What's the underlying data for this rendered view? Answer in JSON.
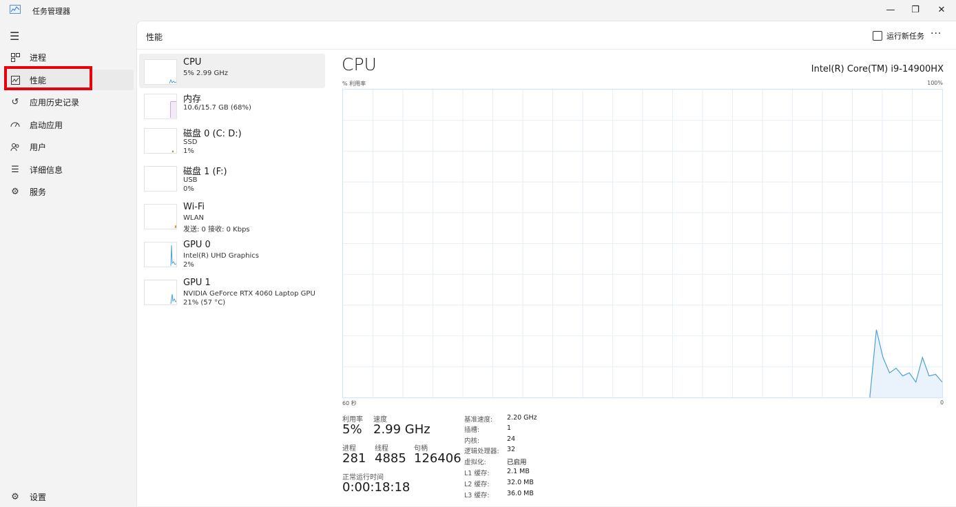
{
  "window": {
    "title": "任务管理器"
  },
  "sidebar": {
    "items": [
      {
        "label": "进程",
        "icon": "processes-icon"
      },
      {
        "label": "性能",
        "icon": "performance-icon"
      },
      {
        "label": "应用历史记录",
        "icon": "history-icon"
      },
      {
        "label": "启动应用",
        "icon": "startup-icon"
      },
      {
        "label": "用户",
        "icon": "users-icon"
      },
      {
        "label": "详细信息",
        "icon": "details-icon"
      },
      {
        "label": "服务",
        "icon": "services-icon"
      }
    ],
    "active_index": 1,
    "settings_label": "设置"
  },
  "header": {
    "title": "性能",
    "run_task": "运行新任务",
    "more": "···"
  },
  "devices": [
    {
      "name": "CPU",
      "line2": "5% 2.99 GHz",
      "line3": ""
    },
    {
      "name": "内存",
      "line2": "10.6/15.7 GB (68%)",
      "line3": ""
    },
    {
      "name": "磁盘 0 (C: D:)",
      "line2": "SSD",
      "line3": "1%"
    },
    {
      "name": "磁盘 1 (F:)",
      "line2": "USB",
      "line3": "0%"
    },
    {
      "name": "Wi-Fi",
      "line2": "WLAN",
      "line3": "发送: 0 接收: 0 Kbps"
    },
    {
      "name": "GPU 0",
      "line2": "Intel(R) UHD Graphics",
      "line3": "2%"
    },
    {
      "name": "GPU 1",
      "line2": "NVIDIA GeForce RTX 4060 Laptop GPU",
      "line3": "21% (57 °C)"
    }
  ],
  "cpu": {
    "title": "CPU",
    "model": "Intel(R) Core(TM) i9-14900HX",
    "util_label": "% 利用率",
    "max_label": "100%",
    "time_label": "60 秒",
    "zero_label": "0",
    "history": [
      0,
      0,
      0,
      0,
      0,
      0,
      0,
      0,
      0,
      0,
      0,
      0,
      0,
      0,
      0,
      0,
      0,
      0,
      0,
      0,
      0,
      0,
      0,
      0,
      0,
      0,
      0,
      0,
      0,
      0,
      0,
      0,
      0,
      0,
      0,
      0,
      0,
      0,
      0,
      0,
      0,
      0,
      0,
      0,
      0,
      0,
      0,
      0,
      0,
      0,
      0,
      0,
      0,
      0,
      0,
      0,
      0,
      0,
      0,
      0,
      0,
      0,
      0,
      0,
      0,
      0,
      0,
      0,
      0,
      0,
      0,
      0,
      0,
      0,
      0,
      0,
      0,
      0,
      0,
      0,
      0,
      22,
      13,
      8,
      9.5,
      7,
      8,
      5,
      13,
      7,
      7.5,
      5
    ]
  },
  "stats": {
    "util": {
      "label": "利用率",
      "value": "5%"
    },
    "speed": {
      "label": "速度",
      "value": "2.99 GHz"
    },
    "processes": {
      "label": "进程",
      "value": "281"
    },
    "threads": {
      "label": "线程",
      "value": "4885"
    },
    "handles": {
      "label": "句柄",
      "value": "126406"
    },
    "uptime": {
      "label": "正常运行时间",
      "value": "0:00:18:18"
    }
  },
  "specs": [
    {
      "k": "基准速度:",
      "v": "2.20 GHz"
    },
    {
      "k": "插槽:",
      "v": "1"
    },
    {
      "k": "内核:",
      "v": "24"
    },
    {
      "k": "逻辑处理器:",
      "v": "32"
    },
    {
      "k": "虚拟化:",
      "v": "已启用"
    },
    {
      "k": "L1 缓存:",
      "v": "2.1 MB"
    },
    {
      "k": "L2 缓存:",
      "v": "32.0 MB"
    },
    {
      "k": "L3 缓存:",
      "v": "36.0 MB"
    }
  ],
  "colors": {
    "accent": "#005fb8",
    "highlight_box": "#e8000b",
    "cpu_line": "#4aa0d8",
    "memory_line": "#a04db8",
    "disk_line": "#5aa02c",
    "wifi_line": "#c58a2b"
  }
}
